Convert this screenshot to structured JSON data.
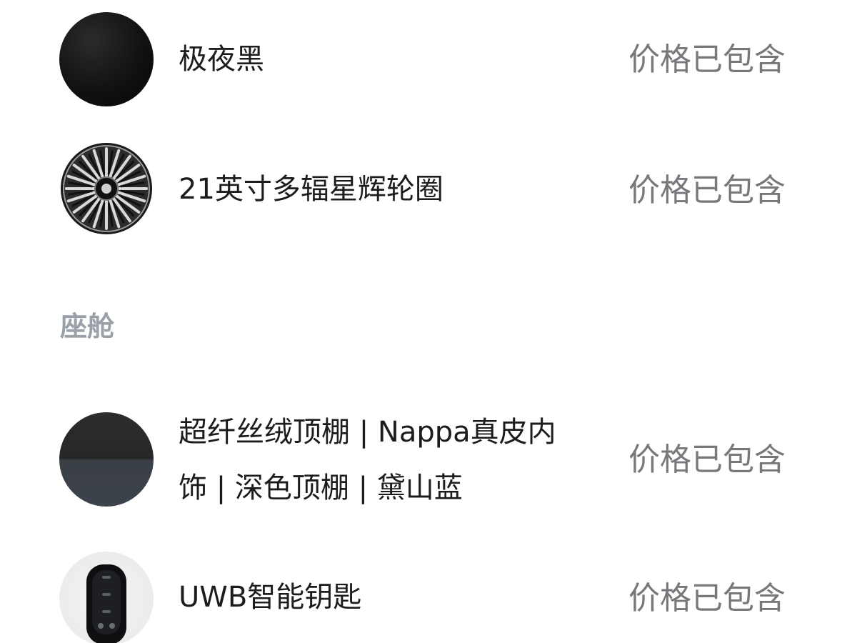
{
  "sections": {
    "cabin_title": "座舱"
  },
  "items": [
    {
      "name": "极夜黑",
      "price": "价格已包含",
      "icon": "paint-swatch-black-icon"
    },
    {
      "name": "21英寸多辐星辉轮圈",
      "price": "价格已包含",
      "icon": "wheel-rim-icon"
    },
    {
      "name": "超纤丝绒顶棚 | Nappa真皮内饰 | 深色顶棚 | 黛山蓝",
      "price": "价格已包含",
      "icon": "interior-swatch-icon"
    },
    {
      "name": "UWB智能钥匙",
      "price": "价格已包含",
      "icon": "smart-key-icon"
    }
  ],
  "colors": {
    "text_primary": "#1c1c1e",
    "text_secondary": "#77787c",
    "section_title": "#9aa0a8"
  }
}
